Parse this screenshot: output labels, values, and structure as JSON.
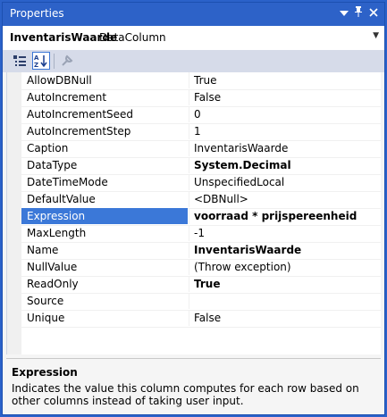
{
  "titlebar": {
    "title": "Properties",
    "icons": [
      "chevron-down-icon",
      "pin-icon",
      "close-icon"
    ]
  },
  "object_selector": {
    "name": "InventarisWaarde",
    "type": "DataColumn"
  },
  "toolbar": {
    "icons": [
      "categorized-icon",
      "alphabetical-icon",
      "property-pages-icon"
    ]
  },
  "properties": [
    {
      "name": "AllowDBNull",
      "value": "True",
      "bold": false
    },
    {
      "name": "AutoIncrement",
      "value": "False",
      "bold": false
    },
    {
      "name": "AutoIncrementSeed",
      "value": "0",
      "bold": false
    },
    {
      "name": "AutoIncrementStep",
      "value": "1",
      "bold": false
    },
    {
      "name": "Caption",
      "value": "InventarisWaarde",
      "bold": false
    },
    {
      "name": "DataType",
      "value": "System.Decimal",
      "bold": true
    },
    {
      "name": "DateTimeMode",
      "value": "UnspecifiedLocal",
      "bold": false
    },
    {
      "name": "DefaultValue",
      "value": "<DBNull>",
      "bold": false
    },
    {
      "name": "Expression",
      "value": "voorraad * prijspereenheid",
      "bold": true,
      "selected": true
    },
    {
      "name": "MaxLength",
      "value": "-1",
      "bold": false
    },
    {
      "name": "Name",
      "value": "InventarisWaarde",
      "bold": true
    },
    {
      "name": "NullValue",
      "value": "(Throw exception)",
      "bold": false
    },
    {
      "name": "ReadOnly",
      "value": "True",
      "bold": true
    },
    {
      "name": "Source",
      "value": "",
      "bold": false
    },
    {
      "name": "Unique",
      "value": "False",
      "bold": false
    }
  ],
  "description": {
    "title": "Expression",
    "text": "Indicates the value this column computes for each row based on other columns instead of taking user input."
  },
  "colors": {
    "titlebar": "#2d62c8",
    "selection": "#3b78d8",
    "toolbar": "#d6dbe9"
  }
}
